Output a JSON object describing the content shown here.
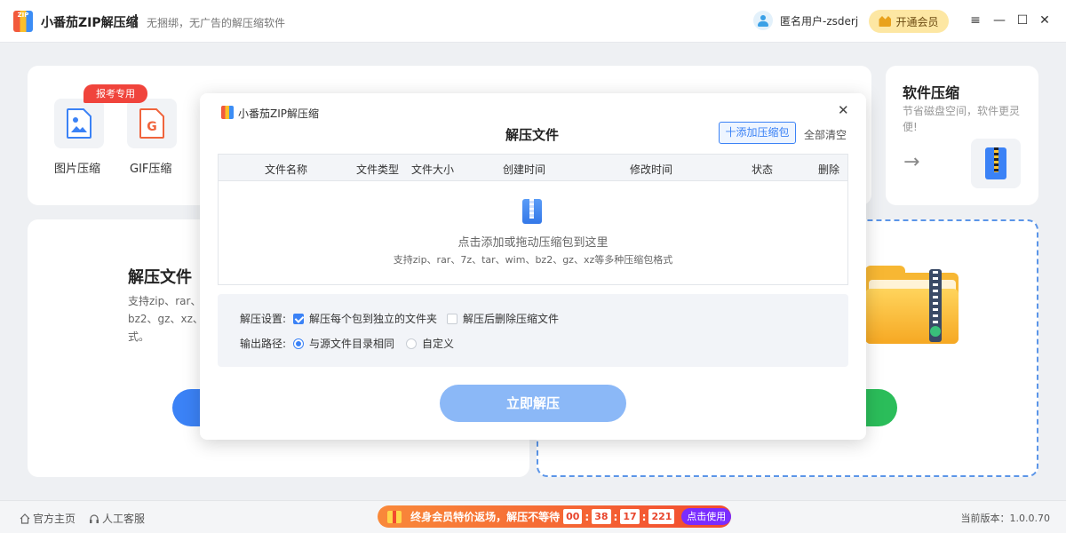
{
  "titlebar": {
    "logo_text": "ZIP",
    "app_name": "小番茄ZIP解压缩",
    "slogan": "无捆绑，无广告的解压缩软件",
    "user_name": "匿名用户-zsderj",
    "vip_label": "开通会员",
    "menu_icon": "≡",
    "minimize_icon": "—",
    "maximize_icon": "☐",
    "close_icon": "✕"
  },
  "tools": {
    "badge": "报考专用",
    "image_label": "图片压缩",
    "gif_label": "GIF压缩",
    "gif_glyph": "G"
  },
  "side_card": {
    "title": "软件压缩",
    "desc": "节省磁盘空间，软件更灵便!",
    "arrow": "→"
  },
  "extract_card": {
    "title": "解压文件",
    "desc_line1": "支持zip、rar、",
    "desc_line2": "bz2、gz、xz、",
    "desc_line3": "式。"
  },
  "modal": {
    "app_name": "小番茄ZIP解压缩",
    "title": "解压文件",
    "add_button": "十添加压缩包",
    "clear_all": "全部清空",
    "close": "✕",
    "columns": [
      "文件名称",
      "文件类型",
      "文件大小",
      "创建时间",
      "修改时间",
      "状态",
      "删除"
    ],
    "drop_hint": "点击添加或拖动压缩包到这里",
    "formats_hint": "支持zip、rar、7z、tar、wim、bz2、gz、xz等多种压缩包格式",
    "settings_label": "解压设置:",
    "option_separate_folder": "解压每个包到独立的文件夹",
    "option_separate_folder_checked": true,
    "option_delete_after": "解压后删除压缩文件",
    "option_delete_after_checked": false,
    "output_label": "输出路径:",
    "output_same_dir": "与源文件目录相同",
    "output_custom": "自定义",
    "output_selected": "same_dir",
    "extract_button": "立即解压"
  },
  "statusbar": {
    "home_link": "官方主页",
    "support_link": "人工客服",
    "promo_text": "终身会员特价返场，解压不等待",
    "countdown": [
      "00",
      "38",
      "17",
      "221"
    ],
    "promo_button": "点击使用",
    "version": "当前版本：1.0.0.70"
  },
  "colors": {
    "accent": "#3b82f6",
    "extract_button": "#8bb8f7",
    "badge": "#f0443c",
    "vip_bg": "#fde7a3",
    "promo": "#f24a2f"
  }
}
